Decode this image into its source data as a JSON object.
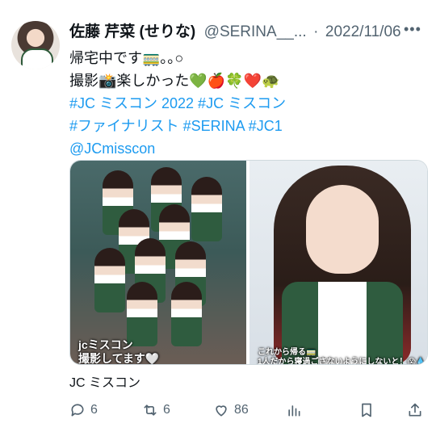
{
  "tweet": {
    "display_name": "佐藤 芹菜 (せりな)",
    "handle": "@SERINA__...",
    "separator": "·",
    "date": "2022/11/06",
    "more_glyph": "•••",
    "lines": [
      "帰宅中です🚃｡｡○",
      "撮影📸楽しかった💚🍎🍀❤️🐢"
    ],
    "hashtag_lines": [
      "#JC ミスコン 2022 #JC ミスコン",
      "#ファイナリスト #SERINA #JC1",
      "@JCmisscon"
    ],
    "media": {
      "left_caption_1": "jcミスコン",
      "left_caption_2": "撮影してます🤍",
      "right_caption_1": "これから帰る🚃",
      "right_caption_2": "1人だから寝過ごさないようにしないと！😱💧"
    },
    "source_label": "JC ミスコン",
    "actions": {
      "reply_count": "6",
      "retweet_count": "6",
      "like_count": "86"
    }
  }
}
